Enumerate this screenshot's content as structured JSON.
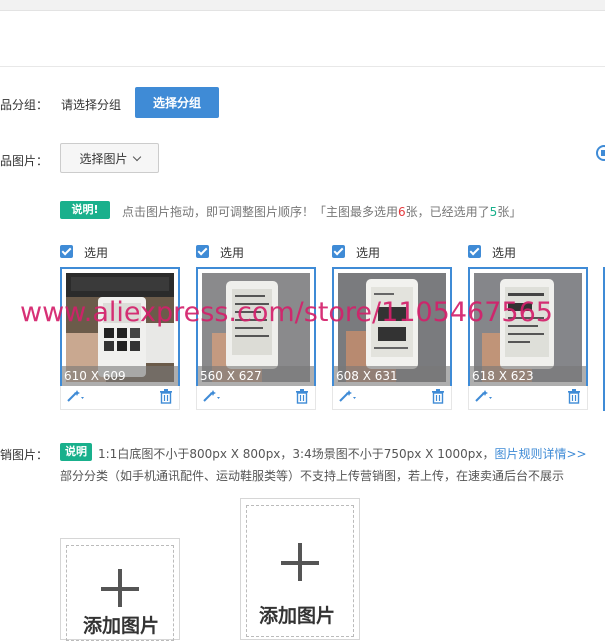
{
  "group": {
    "label": "品分组：",
    "placeholder": "请选择分组",
    "button": "选择分组"
  },
  "images": {
    "label": "品图片：",
    "select_button": "选择图片",
    "note_badge": "说明!",
    "note_text_1": "点击图片拖动，即可调整图片顺序！「主图最多选用",
    "note_max": "6",
    "note_text_2": "张，已经选用了",
    "note_used": "5",
    "note_text_3": "张」",
    "cards": [
      {
        "checkbox_label": "选用",
        "size": "610 X 609"
      },
      {
        "checkbox_label": "选用",
        "size": "560 X 627"
      },
      {
        "checkbox_label": "选用",
        "size": "608 X 631"
      },
      {
        "checkbox_label": "选用",
        "size": "618 X 623"
      }
    ]
  },
  "watermark": "www.aliexpress.com/store/1105467565",
  "marketing": {
    "label": "销图片：",
    "note_badge": "说明",
    "line1": "1:1白底图不小于800px X 800px，3:4场景图不小于750px X 1000px，",
    "link": "图片规则详情>>",
    "line2": "部分分类（如手机通讯配件、运动鞋服类等）不支持上传营销图，若上传，在速卖通后台不展示",
    "add_label_1": "添加图片",
    "add_label_2": "添加图片"
  },
  "colors": {
    "primary": "#3f8bd6",
    "note_green": "#19b08c",
    "watermark": "#d4206b",
    "highlight_red": "#e4393c"
  },
  "icons": [
    "magic-wand-icon",
    "trash-icon",
    "checkbox-checked-icon",
    "chevron-down-icon",
    "plus-icon",
    "settings-icon"
  ]
}
